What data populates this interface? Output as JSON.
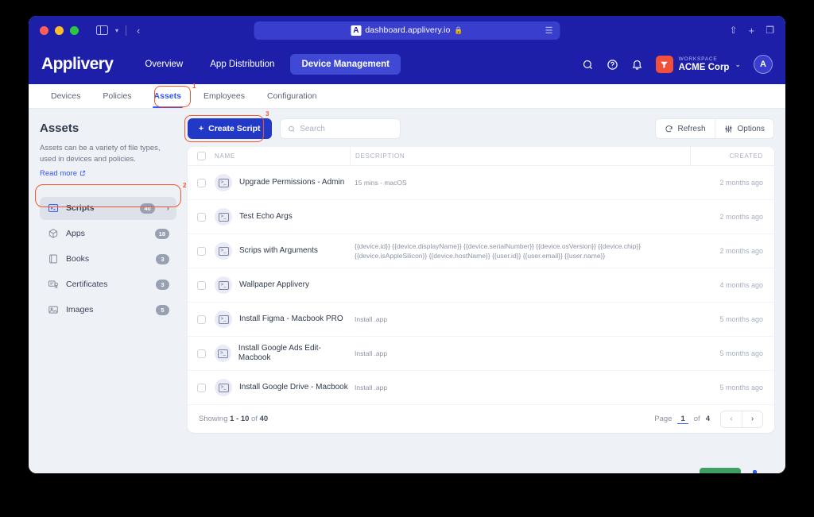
{
  "browser": {
    "url": "dashboard.applivery.io",
    "favicon": "applivery-favicon-icon",
    "lock": "lock-icon",
    "back_icon": "back-chevron-icon",
    "sidebar_icon": "sidebar-toggle-icon",
    "share_icon": "share-icon",
    "newtab_icon": "plus-icon",
    "tabs_icon": "tabs-icon",
    "reader_icon": "reader-view-icon"
  },
  "header": {
    "logo": "Applivery",
    "nav": [
      {
        "label": "Overview",
        "active": false
      },
      {
        "label": "App Distribution",
        "active": false
      },
      {
        "label": "Device Management",
        "active": true
      }
    ],
    "search_icon": "search-icon",
    "help_icon": "help-circle-icon",
    "bell_icon": "bell-icon",
    "workspace_label": "WORKSPACE",
    "workspace_name": "ACME Corp",
    "workspace_chevron": "chevron-down-icon",
    "avatar_letter": "A"
  },
  "subtabs": [
    {
      "label": "Devices",
      "active": false
    },
    {
      "label": "Policies",
      "active": false
    },
    {
      "label": "Assets",
      "active": true
    },
    {
      "label": "Employees",
      "active": false
    },
    {
      "label": "Configuration",
      "active": false
    }
  ],
  "annotations": {
    "tab": "1",
    "sidebar": "2",
    "create": "3"
  },
  "sidebar": {
    "title": "Assets",
    "description": "Assets can be a variety of file types, used in devices and policies.",
    "read_more": "Read more",
    "read_more_icon": "external-link-icon",
    "items": [
      {
        "label": "Scripts",
        "count": "40",
        "icon": "terminal-icon",
        "active": true,
        "chevron": "chevron-right-icon"
      },
      {
        "label": "Apps",
        "count": "18",
        "icon": "package-icon",
        "active": false
      },
      {
        "label": "Books",
        "count": "3",
        "icon": "book-icon",
        "active": false
      },
      {
        "label": "Certificates",
        "count": "3",
        "icon": "certificate-icon",
        "active": false
      },
      {
        "label": "Images",
        "count": "5",
        "icon": "image-icon",
        "active": false
      }
    ]
  },
  "toolbar": {
    "create_label": "Create Script",
    "create_icon": "plus-icon",
    "search_placeholder": "Search",
    "search_value": "",
    "search_icon": "search-icon",
    "refresh_label": "Refresh",
    "refresh_icon": "refresh-icon",
    "options_label": "Options",
    "options_icon": "sliders-icon"
  },
  "table": {
    "columns": {
      "name": "NAME",
      "description": "DESCRIPTION",
      "created": "CREATED"
    },
    "rows": [
      {
        "name": "Upgrade Permissions - Admin",
        "description": "15 mins - macOS",
        "created": "2 months ago"
      },
      {
        "name": "Test Echo Args",
        "description": "",
        "created": "2 months ago"
      },
      {
        "name": "Scrips with Arguments",
        "description": "{{device.id}} {{device.displayName}} {{device.serialNumber}} {{device.osVersion}} {{device.chip}} {{device.isAppleSilicon}} {{device.hostName}} {{user.id}} {{user.email}} {{user.name}}",
        "created": "2 months ago"
      },
      {
        "name": "Wallpaper Applivery",
        "description": "",
        "created": "4 months ago"
      },
      {
        "name": "Install Figma - Macbook PRO",
        "description": "Install .app",
        "created": "5 months ago"
      },
      {
        "name": "Install Google Ads Edit- Macbook",
        "description": "Install .app",
        "created": "5 months ago"
      },
      {
        "name": "Install Google Drive - Macbook",
        "description": "Install .app",
        "created": "5 months ago"
      }
    ],
    "footer": {
      "showing_prefix": "Showing",
      "showing_range": "1 - 10",
      "showing_of": "of",
      "showing_total": "40",
      "page_label": "Page",
      "page_number": "1",
      "page_of": "of",
      "page_total": "4",
      "prev_icon": "chevron-left-icon",
      "next_icon": "chevron-right-icon"
    }
  },
  "colors": {
    "brand_navy": "#1d1fa8",
    "accent_blue": "#3358f4",
    "primary_button": "#2239c7",
    "annotation": "#f4552c",
    "workspace_tile": "#f0513c"
  }
}
